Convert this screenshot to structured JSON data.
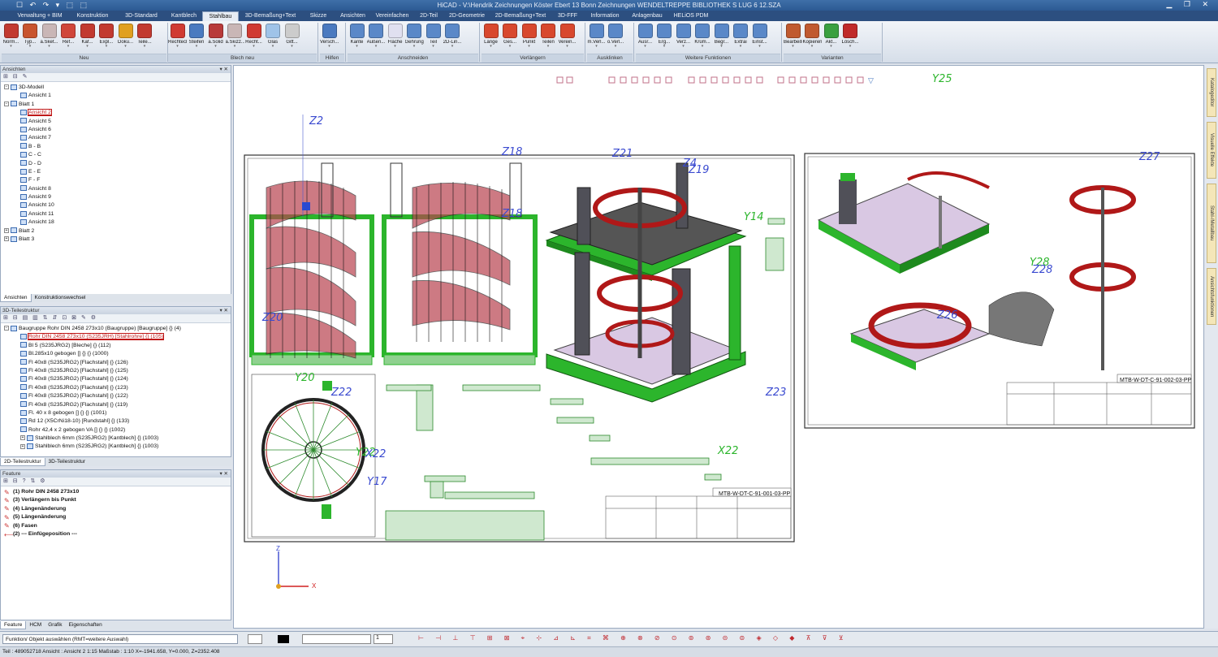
{
  "window": {
    "title": "HiCAD - V:\\Hendrik Zeichnungen Köster Ebert 13 Bonn Zeichnungen WENDELTREPPE BIBLIOTHEK S LUG 6 12.SZA",
    "controls": "▁ ❐ ✕",
    "quick_access": "☐ ↶ ↷ ▾ ⬚ ⬚"
  },
  "menu_tabs": [
    "Verwaltung + BIM",
    "Konstruktion",
    "3D-Standard",
    "Kantblech",
    "Stahlbau",
    "3D-Bemaßung+Text",
    "Skizze",
    "Ansichten",
    "Vereinfachen",
    "2D-Teil",
    "2D-Geometrie",
    "2D-Bemaßung+Text",
    "3D-FFF",
    "Information",
    "Anlagenbau",
    "HELiOS PDM"
  ],
  "active_tab": "Stahlbau",
  "ribbon": {
    "buttons": [
      {
        "label": "Norm...",
        "color": "#c23a30"
      },
      {
        "label": "Typ...",
        "color": "#c8542e"
      },
      {
        "label": "a.Sket...",
        "color": "#c9b6b6"
      },
      {
        "label": "Ref...",
        "color": "#d0463a"
      },
      {
        "label": "Kaf...",
        "color": "#c23a30"
      },
      {
        "label": "Expl...",
        "color": "#c23a30"
      },
      {
        "label": "Doku...",
        "color": "#e0a020"
      },
      {
        "label": "Teile...",
        "color": "#c23a30"
      },
      {
        "label": "Rechteck",
        "color": "#d03a32"
      },
      {
        "label": "Steifen",
        "color": "#4a7ac0"
      },
      {
        "label": "a.Solid",
        "color": "#b83a3a"
      },
      {
        "label": "a.Skizz...",
        "color": "#c9b6b6"
      },
      {
        "label": "Recht...",
        "color": "#d03a32"
      },
      {
        "label": "Glas",
        "color": "#9fc3e8"
      },
      {
        "label": "Gitt...",
        "color": "#cccccc"
      },
      {
        "label": "Versch...",
        "color": "#4a7ac0"
      },
      {
        "label": "Kante",
        "color": "#5a88c8"
      },
      {
        "label": "Außen...",
        "color": "#5a88c8"
      },
      {
        "label": "Fläche",
        "color": "#e0e0f0"
      },
      {
        "label": "Gehrung",
        "color": "#5a88c8"
      },
      {
        "label": "Teil",
        "color": "#5a88c8"
      },
      {
        "label": "2D-Lin...",
        "color": "#5a88c8"
      },
      {
        "label": "Länge",
        "color": "#d8482e"
      },
      {
        "label": "Ges...",
        "color": "#d8482e"
      },
      {
        "label": "Punkt",
        "color": "#d8482e"
      },
      {
        "label": "Teilen",
        "color": "#d8482e"
      },
      {
        "label": "Verein...",
        "color": "#d8482e"
      },
      {
        "label": "m.Verl...",
        "color": "#5a88c8"
      },
      {
        "label": "o.Verl...",
        "color": "#5a88c8"
      },
      {
        "label": "Ausr...",
        "color": "#5a88c8"
      },
      {
        "label": "Erg...",
        "color": "#5a88c8"
      },
      {
        "label": "Verz...",
        "color": "#5a88c8"
      },
      {
        "label": "Krüm...",
        "color": "#5a88c8"
      },
      {
        "label": "Begr...",
        "color": "#5a88c8"
      },
      {
        "label": "Extrai",
        "color": "#5a88c8"
      },
      {
        "label": "Einst...",
        "color": "#5a88c8"
      },
      {
        "label": "Bearbeiten",
        "color": "#c05a30"
      },
      {
        "label": "Kopieren",
        "color": "#c05a30"
      },
      {
        "label": "Akt...",
        "color": "#3aa040"
      },
      {
        "label": "Lösch...",
        "color": "#c02a2a"
      }
    ],
    "groups": [
      "Neu",
      "Blech neu",
      "Hilfen",
      "Anschneiden",
      "Verlängern",
      "Ausklinken",
      "Weitere Funktionen",
      "Varianten"
    ]
  },
  "views_panel": {
    "title": "Ansichten",
    "toolbar": "⊞ ⊟ ✎",
    "items": [
      {
        "label": "3D-Modell",
        "level": 0,
        "exp": "−"
      },
      {
        "label": "Ansicht 1",
        "level": 1
      },
      {
        "label": "Blatt 1",
        "level": 0,
        "exp": "−"
      },
      {
        "label": "Ansicht 2",
        "level": 1,
        "highlight": true
      },
      {
        "label": "Ansicht 5",
        "level": 1
      },
      {
        "label": "Ansicht 6",
        "level": 1
      },
      {
        "label": "Ansicht 7",
        "level": 1
      },
      {
        "label": "B - B",
        "level": 1
      },
      {
        "label": "C - C",
        "level": 1
      },
      {
        "label": "D - D",
        "level": 1
      },
      {
        "label": "E - E",
        "level": 1
      },
      {
        "label": "F - F",
        "level": 1
      },
      {
        "label": "Ansicht 8",
        "level": 1
      },
      {
        "label": "Ansicht 9",
        "level": 1
      },
      {
        "label": "Ansicht 10",
        "level": 1
      },
      {
        "label": "Ansicht 11",
        "level": 1
      },
      {
        "label": "Ansicht 18",
        "level": 1
      },
      {
        "label": "Blatt 2",
        "level": 0,
        "exp": "+"
      },
      {
        "label": "Blatt 3",
        "level": 0,
        "exp": "+"
      }
    ],
    "tabs": [
      "Ansichten",
      "Konstruktionswechsel"
    ]
  },
  "structure_panel": {
    "title": "3D-Teilestruktur",
    "toolbar": "⊞ ⊟ ▤ ▥ ⇅ ⇵ ⊡ ⊠ ✎ ⚙",
    "items": [
      {
        "label": "Baugruppe Rohr DIN 2458 273x10 (Baugruppe) [Baugruppe] {} (4)",
        "level": 0,
        "exp": "−"
      },
      {
        "label": "Rohr DIN 2458 273x10 (S235JRH) [Stahlrohre] {} (105)",
        "level": 1,
        "highlight": true
      },
      {
        "label": "Bl 5 (S235JRG2) [Bleche] {} (112)",
        "level": 1
      },
      {
        "label": "Bl.285x10 gebogen [] {} {} (1000)",
        "level": 1
      },
      {
        "label": "Fl 40x8 (S235JRG2) [Flachstahl] {} (126)",
        "level": 1
      },
      {
        "label": "Fl 40x8 (S235JRG2) [Flachstahl] {} (125)",
        "level": 1
      },
      {
        "label": "Fl 40x8 (S235JRG2) [Flachstahl] {} (124)",
        "level": 1
      },
      {
        "label": "Fl 40x8 (S235JRG2) [Flachstahl] {} (123)",
        "level": 1
      },
      {
        "label": "Fl 40x8 (S235JRG2) [Flachstahl] {} (122)",
        "level": 1
      },
      {
        "label": "Fl 40x8 (S235JRG2) [Flachstahl] {} (119)",
        "level": 1
      },
      {
        "label": "Fl. 40 x 8 gebogen [] {} {} (1001)",
        "level": 1
      },
      {
        "label": "Rd 12 (X5CrNi18-10) [Rundstahl] {} (133)",
        "level": 1
      },
      {
        "label": "Rohr 42,4 x 2 gebogen VA [] {} {} (1002)",
        "level": 1
      },
      {
        "label": "Stahlblech 6mm (S235JRG2) [Kantblech] {} (1003)",
        "level": 1,
        "exp": "+"
      },
      {
        "label": "Stahlblech 6mm (S235JRG2) [Kantblech] {} (1003)",
        "level": 1,
        "exp": "+"
      }
    ],
    "tabs": [
      "2D-Teilestruktur",
      "3D-Teilestruktur"
    ]
  },
  "feature_panel": {
    "title": "Feature",
    "toolbar": "⊞ ⊟ ? ⇅ ⚙",
    "items": [
      {
        "label": "(1) Rohr DIN 2458 273x10",
        "bold": true
      },
      {
        "label": "(3) Verlängern bis Punkt",
        "bold": true
      },
      {
        "label": "(4) Längenänderung",
        "bold": true
      },
      {
        "label": "(5) Längenänderung",
        "bold": true
      },
      {
        "label": "(6) Fasen",
        "bold": true
      },
      {
        "label": "(2) --- Einfügeposition ---",
        "bold": true,
        "arrow": true
      }
    ],
    "tabs": [
      "Feature",
      "HCM",
      "Grafik",
      "Eigenschaften"
    ]
  },
  "right_tabs": [
    "Katalogeditor",
    "Visuelle Effekte",
    "Stahl-/Metallbau",
    "Ansichtsfunktionen"
  ],
  "drawing": {
    "sheet1_title": "MTB-W-DT-C-91-001-03-PP",
    "sheet2_title": "MTB-W-DT-C-91-002-03-PP",
    "labels": [
      "Z2",
      "Z18",
      "Z21",
      "Z4",
      "Z19",
      "Z18",
      "Y25",
      "Z27",
      "Z20",
      "Y20",
      "Z22",
      "Y22",
      "X22",
      "Y17",
      "Y14",
      "Z23",
      "Y28",
      "Z28",
      "Z26",
      "X22"
    ],
    "axes": {
      "z": "Z",
      "x": "X"
    },
    "colors": {
      "green": "#2cb52c",
      "pink": "#d9c8e3",
      "rail": "#b01818",
      "dark": "#505058"
    }
  },
  "status": {
    "command": "Funktion/ Objekt auswählen (RMT=weitere Auswahl)",
    "layer": "1",
    "coords": "Teil : 489052718    Ansicht : Ansicht 2 1:15    Maßstab : 1:10    X=-1941.658, Y=0.000, Z=2352.408",
    "icons": "⊢ ⊣ ⊥ ⊤ ⊞ ⊠ ⌖ ⊹ ⊿ ⊾ ⌗ ⌘ ⊕ ⊗ ⊘ ⊙ ⊚ ⊛ ⊝ ⊜ ◈ ◇ ◆ ⊼ ⊽ ⊻"
  }
}
